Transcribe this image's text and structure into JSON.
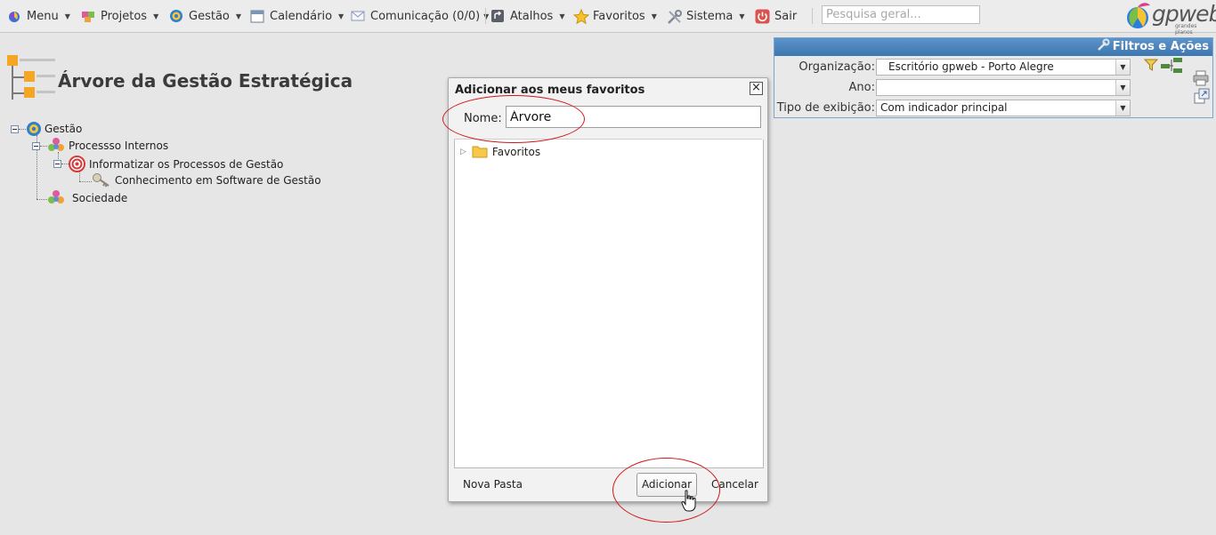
{
  "menu": {
    "items": [
      {
        "label": "Menu",
        "icon": "menu-logo-icon"
      },
      {
        "label": "Projetos",
        "icon": "puzzle-icon"
      },
      {
        "label": "Gestão",
        "icon": "gestao-icon"
      },
      {
        "label": "Calendário",
        "icon": "calendar-icon"
      },
      {
        "label": "Comunicação (0/0)",
        "icon": "envelope-icon"
      },
      {
        "label": "Atalhos",
        "icon": "shortcut-icon"
      },
      {
        "label": "Favoritos",
        "icon": "star-icon"
      },
      {
        "label": "Sistema",
        "icon": "tools-icon"
      },
      {
        "label": "Sair",
        "icon": "power-icon"
      }
    ],
    "search_placeholder": "Pesquisa geral...",
    "logo_text": "gpweb",
    "logo_subtext": "grandes planos"
  },
  "page": {
    "title": "Árvore da Gestão Estratégica"
  },
  "tree": {
    "nodes": [
      {
        "label": "Gestão"
      },
      {
        "label": "Processso Internos"
      },
      {
        "label": "Informatizar os Processos de Gestão"
      },
      {
        "label": "Conhecimento em Software de Gestão"
      },
      {
        "label": "Sociedade"
      }
    ]
  },
  "filters": {
    "header": "Filtros e Ações",
    "rows": [
      {
        "label": "Organização:",
        "value": "Escritório gpweb - Porto Alegre"
      },
      {
        "label": "Ano:",
        "value": ""
      },
      {
        "label": "Tipo de exibição:",
        "value": "Com indicador principal"
      }
    ]
  },
  "dialog": {
    "title": "Adicionar aos meus favoritos",
    "close_label": "×",
    "name_label": "Nome:",
    "name_value": "Árvore",
    "folder_label": "Favoritos",
    "new_folder_label": "Nova Pasta",
    "add_label": "Adicionar",
    "cancel_label": "Cancelar"
  },
  "colors": {
    "accent": "#3d76b0",
    "annotation": "#d41616",
    "tree_orange": "#f5a623"
  }
}
